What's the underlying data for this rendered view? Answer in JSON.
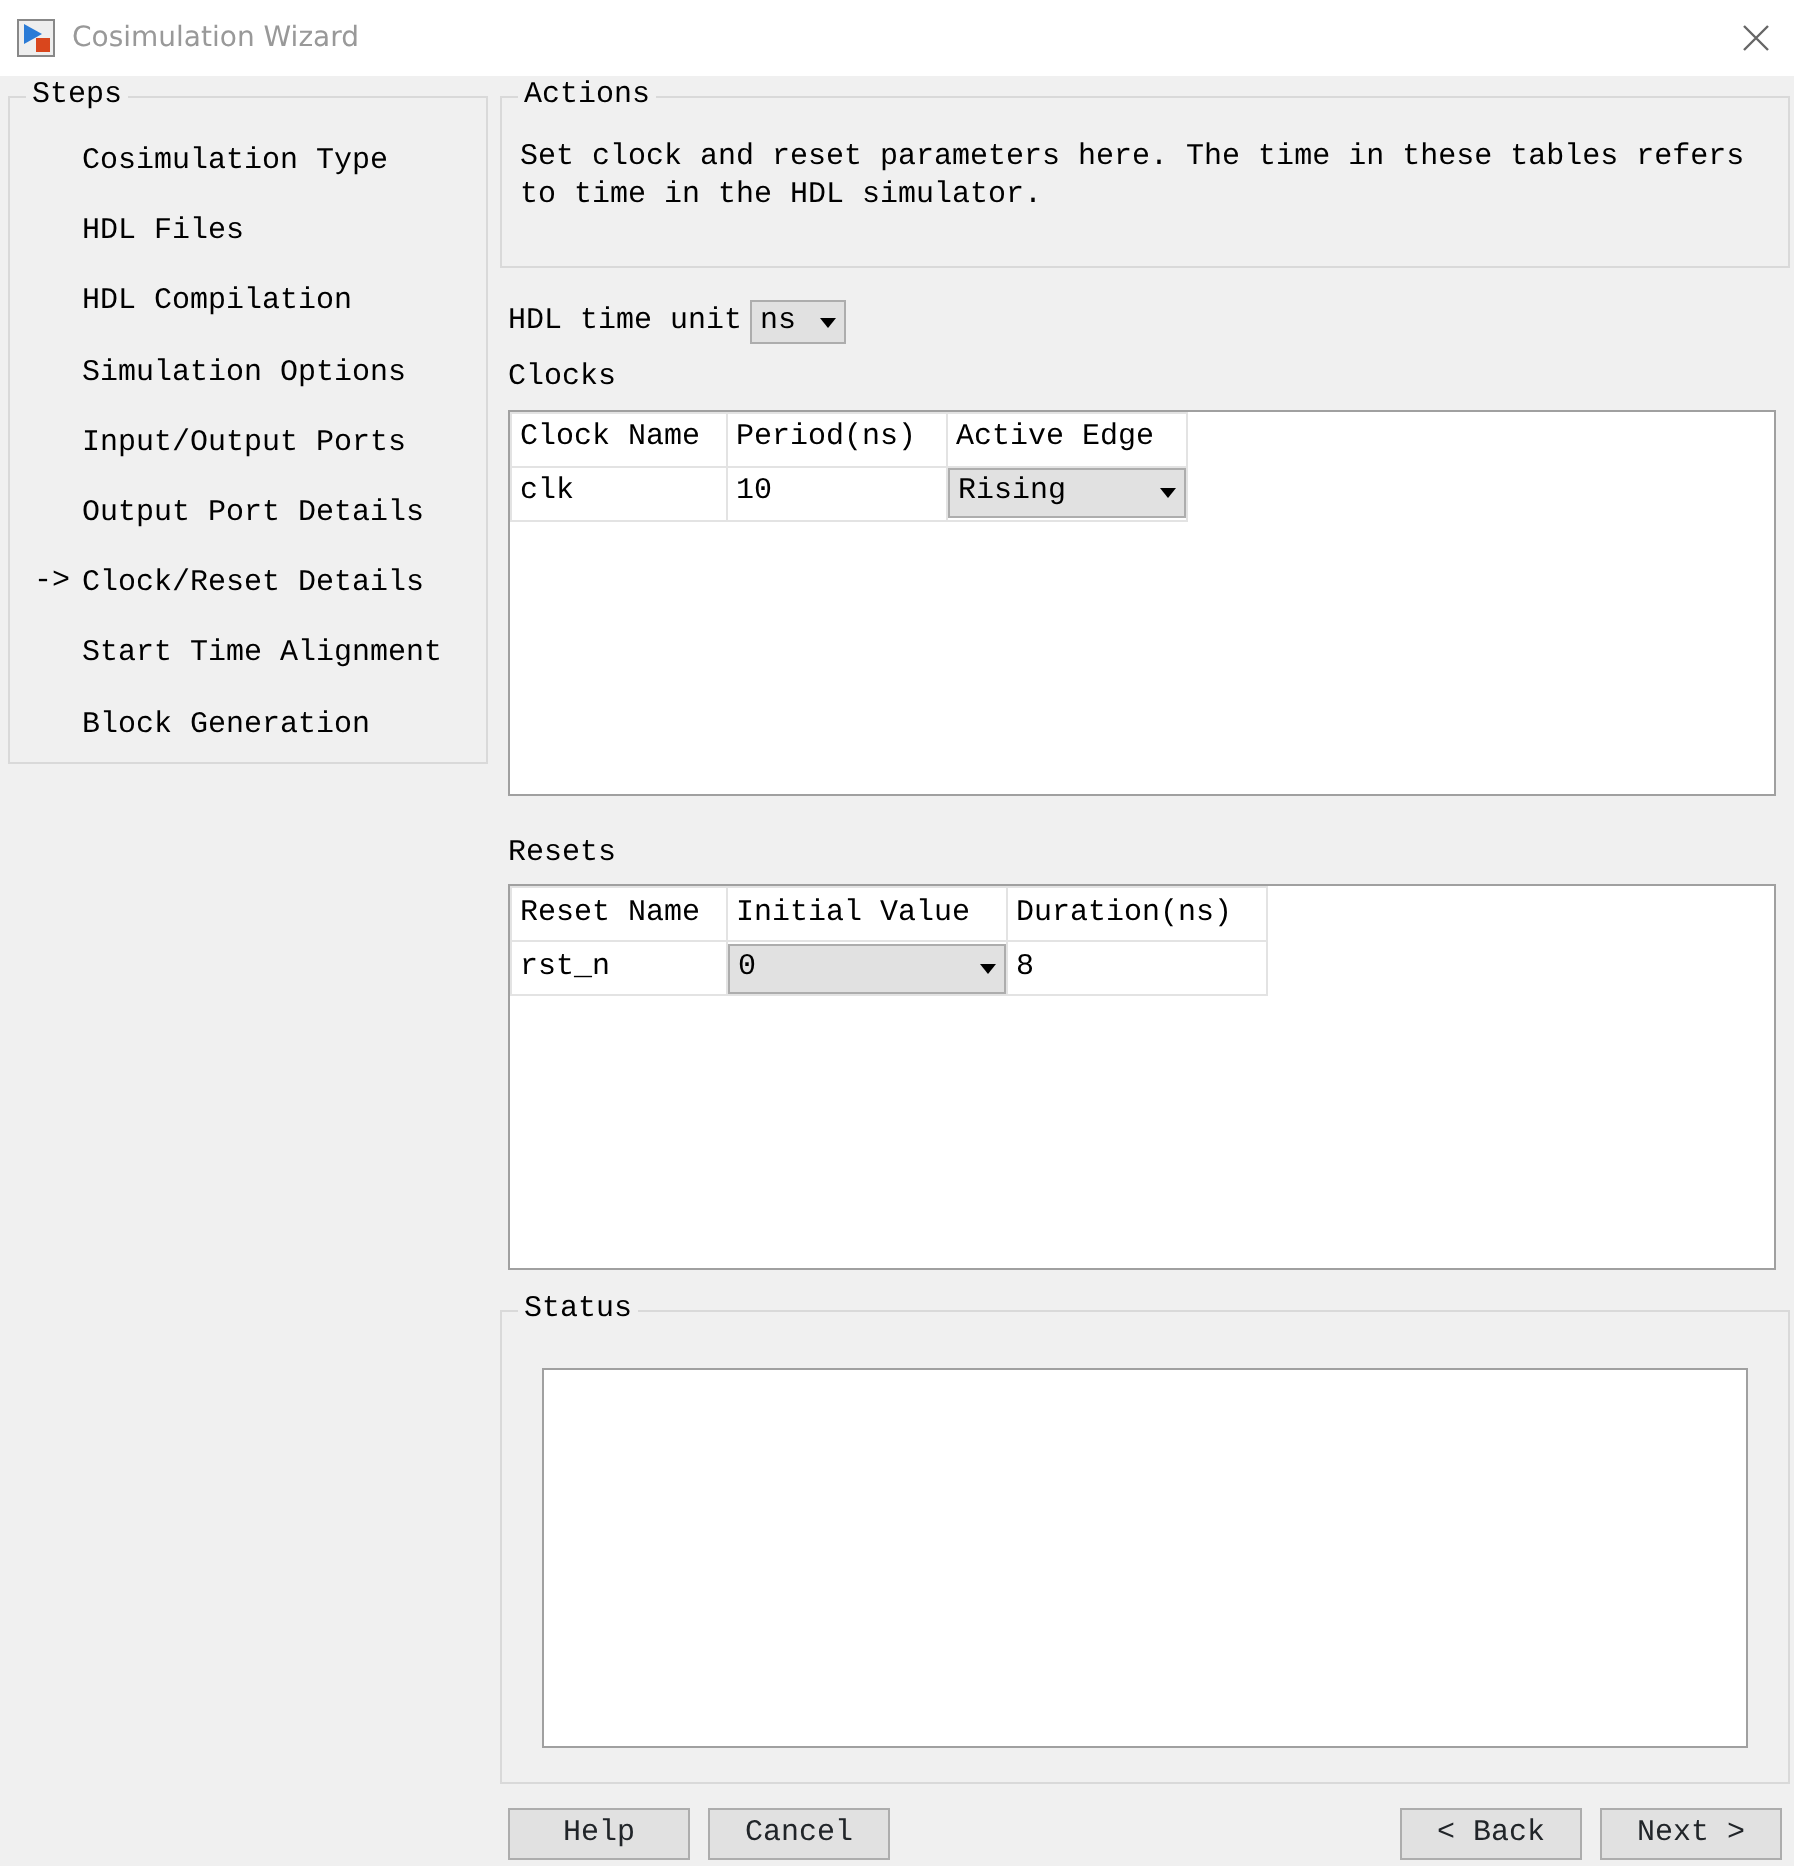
{
  "window": {
    "title": "Cosimulation Wizard"
  },
  "steps": {
    "title": "Steps",
    "marker": "->",
    "items": [
      {
        "label": "Cosimulation Type",
        "selected": false
      },
      {
        "label": "HDL Files",
        "selected": false
      },
      {
        "label": "HDL Compilation",
        "selected": false
      },
      {
        "label": "Simulation Options",
        "selected": false
      },
      {
        "label": "Input/Output Ports",
        "selected": false
      },
      {
        "label": "Output Port Details",
        "selected": false
      },
      {
        "label": "Clock/Reset Details",
        "selected": true
      },
      {
        "label": "Start Time Alignment",
        "selected": false
      },
      {
        "label": "Block Generation",
        "selected": false
      }
    ]
  },
  "actions": {
    "title": "Actions",
    "text": "Set clock and reset parameters here. The time in these tables refers to time in the HDL simulator."
  },
  "time_unit": {
    "label": "HDL time unit",
    "value": "ns"
  },
  "tables": [
    {
      "title": "Clocks",
      "columns": [
        "Clock Name",
        "Period(ns)",
        "Active Edge"
      ],
      "rows": [
        [
          {
            "kind": "text",
            "value": "clk"
          },
          {
            "kind": "text",
            "value": "10"
          },
          {
            "kind": "dropdown",
            "value": "Rising"
          }
        ]
      ]
    },
    {
      "title": "Resets",
      "columns": [
        "Reset Name",
        "Initial Value",
        "Duration(ns)"
      ],
      "rows": [
        [
          {
            "kind": "text",
            "value": "rst_n"
          },
          {
            "kind": "dropdown",
            "value": "0"
          },
          {
            "kind": "text",
            "value": "8"
          }
        ]
      ]
    }
  ],
  "status": {
    "title": "Status"
  },
  "buttons": {
    "left": [
      "Help",
      "Cancel"
    ],
    "right": [
      "< Back",
      "Next >"
    ]
  }
}
